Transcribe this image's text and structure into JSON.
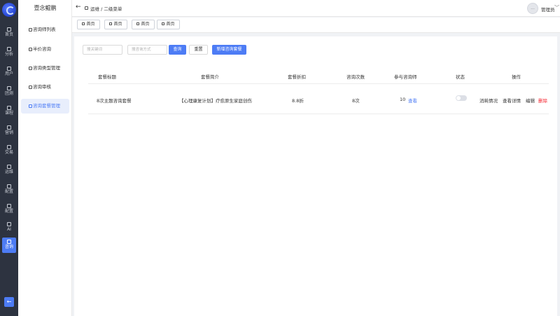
{
  "rail": {
    "items": [
      {
        "label": "首页",
        "icon": "home-icon"
      },
      {
        "label": "分析",
        "icon": "chart-icon"
      },
      {
        "label": "用户",
        "icon": "user-icon"
      },
      {
        "label": "团测",
        "icon": "group-icon"
      },
      {
        "label": "课程",
        "icon": "book-icon"
      },
      {
        "label": "营销",
        "icon": "megaphone-icon"
      },
      {
        "label": "交易",
        "icon": "wallet-icon"
      },
      {
        "label": "运维",
        "icon": "tools-icon"
      },
      {
        "label": "配置",
        "icon": "settings-icon"
      },
      {
        "label": "配置",
        "icon": "settings-icon"
      },
      {
        "label": "AI",
        "icon": "ai-icon"
      },
      {
        "label": "咨询",
        "icon": "consult-icon",
        "active": true
      }
    ],
    "collapse_symbol": "←"
  },
  "sidebar": {
    "title": "壹念鲲鹏",
    "items": [
      {
        "label": "咨询师列表"
      },
      {
        "label": "半价咨询"
      },
      {
        "label": "咨询类型管理"
      },
      {
        "label": "咨询审核"
      },
      {
        "label": "咨询套餐管理",
        "active": true
      }
    ]
  },
  "header": {
    "back_symbol": "←",
    "breadcrumb": "运维 / 二级菜单",
    "avatar_text": "...",
    "user_name": "管理员",
    "caret": "﹀"
  },
  "tabs": [
    {
      "label": "首页"
    },
    {
      "label": "首页"
    },
    {
      "label": "首页"
    },
    {
      "label": "首页"
    }
  ],
  "filters": {
    "keyword_placeholder": "搜关键词",
    "method_placeholder": "搜咨询方式",
    "query_label": "查询",
    "reset_label": "重置",
    "add_label": "新增咨询套餐"
  },
  "table": {
    "columns": [
      "套餐标题",
      "套餐简介",
      "套餐折扣",
      "咨询次数",
      "参与咨询师",
      "状态",
      "操作"
    ],
    "rows": [
      {
        "title": "8次主题咨询套餐",
        "intro": "【心理康复计划】疗愈原生家庭创伤",
        "discount": "8.8折",
        "count": "8次",
        "counselors_num": "10",
        "counselors_link": "查看",
        "status_on": false,
        "actions": [
          "消耗情况",
          "查看详情",
          "编辑",
          "删除"
        ]
      }
    ]
  },
  "colors": {
    "accent": "#4d7cf5",
    "danger": "#f5222d",
    "rail_bg": "#2d3340"
  }
}
